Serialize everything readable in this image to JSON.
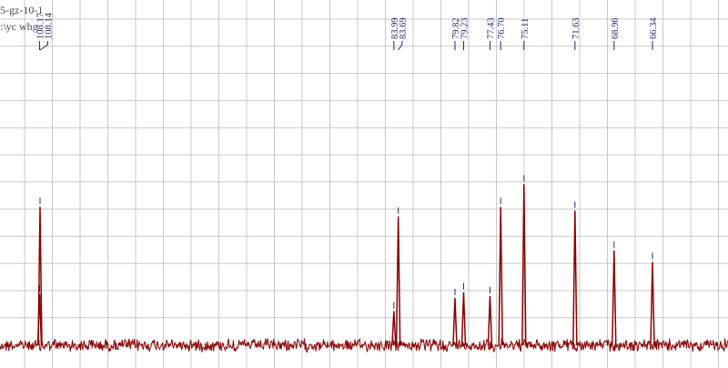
{
  "file_info": {
    "line1": "5-gz-10-1",
    "line2": ":\\yc whg"
  },
  "colors": {
    "spectrum": "#8b0000",
    "peak_labels": "#1f2a6b",
    "grid": "#c8c8c8",
    "background": "#ffffff"
  },
  "chart_data": {
    "type": "line",
    "title": "",
    "xlabel": "",
    "ylabel": "",
    "x_direction": "descending",
    "grid": true,
    "peaks": [
      {
        "label": "108.14",
        "shift": 108.14,
        "intensity": 0.73
      },
      {
        "label": "108.17",
        "shift": 108.17,
        "intensity": 0.27
      },
      {
        "label": "83.99",
        "shift": 83.99,
        "intensity": 0.18
      },
      {
        "label": "83.69",
        "shift": 83.69,
        "intensity": 0.68
      },
      {
        "label": "79.82",
        "shift": 79.82,
        "intensity": 0.25
      },
      {
        "label": "79.23",
        "shift": 79.23,
        "intensity": 0.28
      },
      {
        "label": "77.43",
        "shift": 77.43,
        "intensity": 0.26
      },
      {
        "label": "76.70",
        "shift": 76.7,
        "intensity": 0.73
      },
      {
        "label": "75.11",
        "shift": 75.11,
        "intensity": 0.85
      },
      {
        "label": "71.63",
        "shift": 71.63,
        "intensity": 0.71
      },
      {
        "label": "68.96",
        "shift": 68.96,
        "intensity": 0.5
      },
      {
        "label": "66.34",
        "shift": 66.34,
        "intensity": 0.44
      }
    ]
  }
}
